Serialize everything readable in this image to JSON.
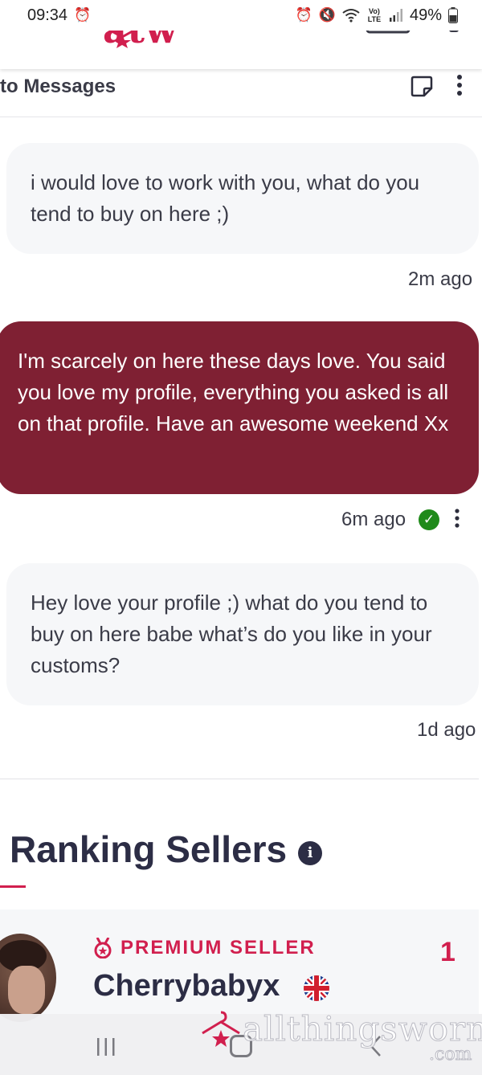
{
  "status_bar": {
    "time": "09:34",
    "battery": "49%",
    "network_label": "Vo) LTE"
  },
  "header": {
    "logo_text": "atw"
  },
  "subheader": {
    "back_label": "to Messages"
  },
  "messages": [
    {
      "direction": "in",
      "text": "i would love to work with you, what do you tend to buy on here ;)",
      "time": "2m ago"
    },
    {
      "direction": "out",
      "text": "I'm scarcely on here these days love. You said you love my profile, everything you asked is all on that profile. Have an awesome weekend Xx",
      "time": "6m ago"
    },
    {
      "direction": "in",
      "text": "Hey love your profile ;) what do you tend to buy on here babe what’s do you like in your customs?",
      "time": "1d ago"
    }
  ],
  "ranking": {
    "title": "Ranking Sellers",
    "seller": {
      "badge": "PREMIUM SELLER",
      "name": "Cherrybabyx",
      "rank": "1"
    }
  },
  "watermark": {
    "text": "allthingsworn",
    "suffix": ".com"
  },
  "colors": {
    "brand": "#d11f4e",
    "outgoing_bubble": "#7f2033",
    "incoming_bubble": "#f6f7f9",
    "dark_text": "#2c2d45",
    "read_check": "#1f8a1a"
  }
}
